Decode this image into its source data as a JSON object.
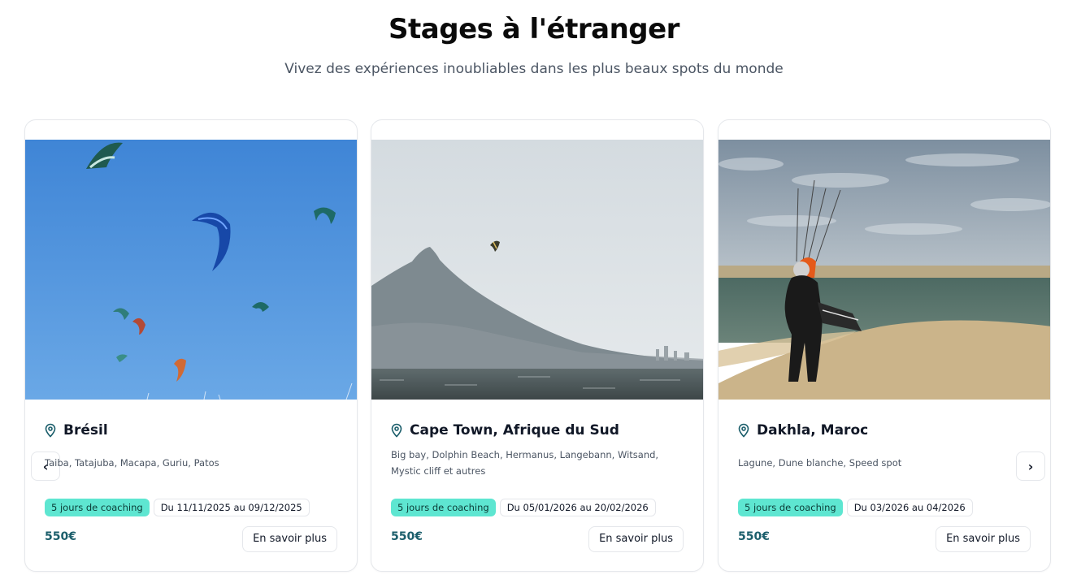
{
  "header": {
    "title": "Stages à l'étranger",
    "subtitle": "Vivez des expériences inoubliables dans les plus beaux spots du monde"
  },
  "carousel": {
    "prev_icon": "chevron-left-icon",
    "next_icon": "chevron-right-icon",
    "prev_glyph": "‹",
    "next_glyph": "›"
  },
  "cards": [
    {
      "location": "Brésil",
      "spots": "Taiba, Tatajuba, Macapa, Guriu, Patos",
      "badge": "5 jours de coaching",
      "dates": "Du 11/11/2025 au 09/12/2025",
      "price": "550€",
      "button": "En savoir plus",
      "image": "kites-blue-sky-image"
    },
    {
      "location": "Cape Town, Afrique du Sud",
      "spots": "Big bay, Dolphin Beach, Hermanus, Langebann, Witsand, Mystic cliff et autres",
      "badge": "5 jours de coaching",
      "dates": "Du 05/01/2026 au 20/02/2026",
      "price": "550€",
      "button": "En savoir plus",
      "image": "table-mountain-kiter-image"
    },
    {
      "location": "Dakhla, Maroc",
      "spots": "Lagune, Dune blanche, Speed spot",
      "badge": "5 jours de coaching",
      "dates": "Du 03/2026 au 04/2026",
      "price": "550€",
      "button": "En savoir plus",
      "image": "dakhla-dune-kiter-image"
    }
  ],
  "colors": {
    "accent_teal": "#5ee6d1",
    "price": "#1b5e6b",
    "pin": "#1b5e6b"
  }
}
